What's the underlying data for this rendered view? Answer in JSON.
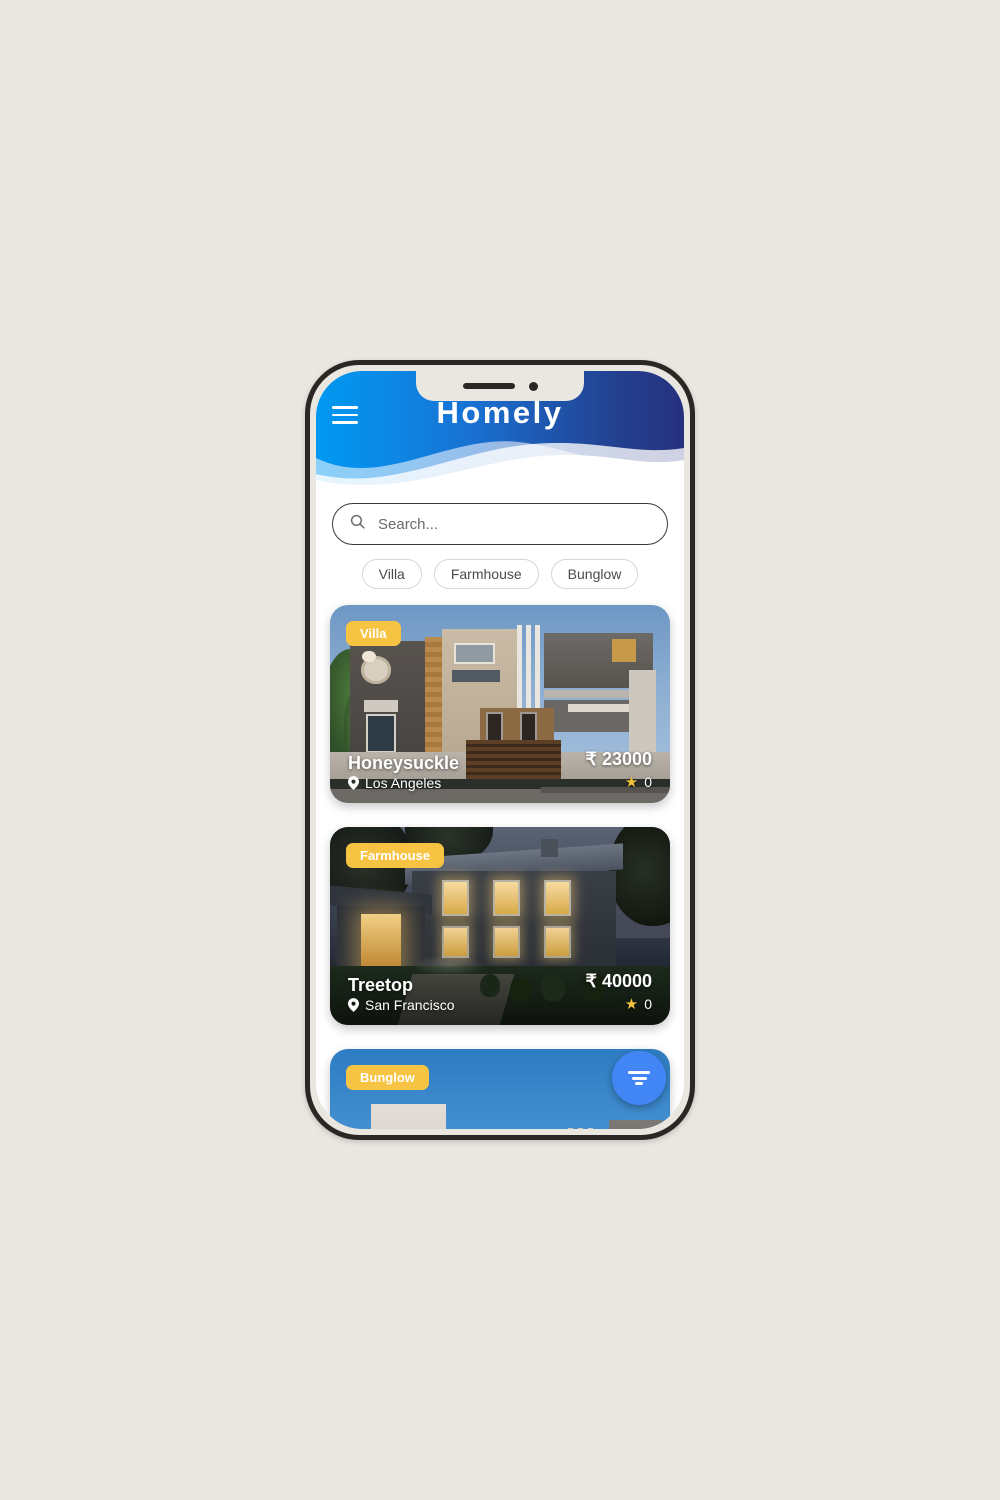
{
  "background_color": "#EAE7E1",
  "app": {
    "title": "Homely",
    "menu_icon": "hamburger-icon",
    "header_gradient_from": "#0099F1",
    "header_gradient_to": "#26317F"
  },
  "search": {
    "placeholder": "Search...",
    "value": "",
    "icon": "search-icon"
  },
  "filters": {
    "chips": [
      {
        "label": "Villa"
      },
      {
        "label": "Farmhouse"
      },
      {
        "label": "Bunglow"
      }
    ]
  },
  "listings": [
    {
      "badge": "Villa",
      "name": "Honeysuckle",
      "location": "Los Angeles",
      "price": "₹ 23000",
      "rating": "0",
      "location_icon": "map-pin-icon",
      "rating_icon": "star-icon"
    },
    {
      "badge": "Farmhouse",
      "name": "Treetop",
      "location": "San Francisco",
      "price": "₹ 40000",
      "rating": "0",
      "location_icon": "map-pin-icon",
      "rating_icon": "star-icon"
    },
    {
      "badge": "Bunglow",
      "name": "",
      "location": "",
      "price": "",
      "rating": "",
      "location_icon": "map-pin-icon",
      "rating_icon": "star-icon"
    }
  ],
  "fab": {
    "icon": "filter-icon",
    "color": "#4285F4"
  },
  "badge_color": "#F7C343",
  "star_color": "#F5C23E"
}
